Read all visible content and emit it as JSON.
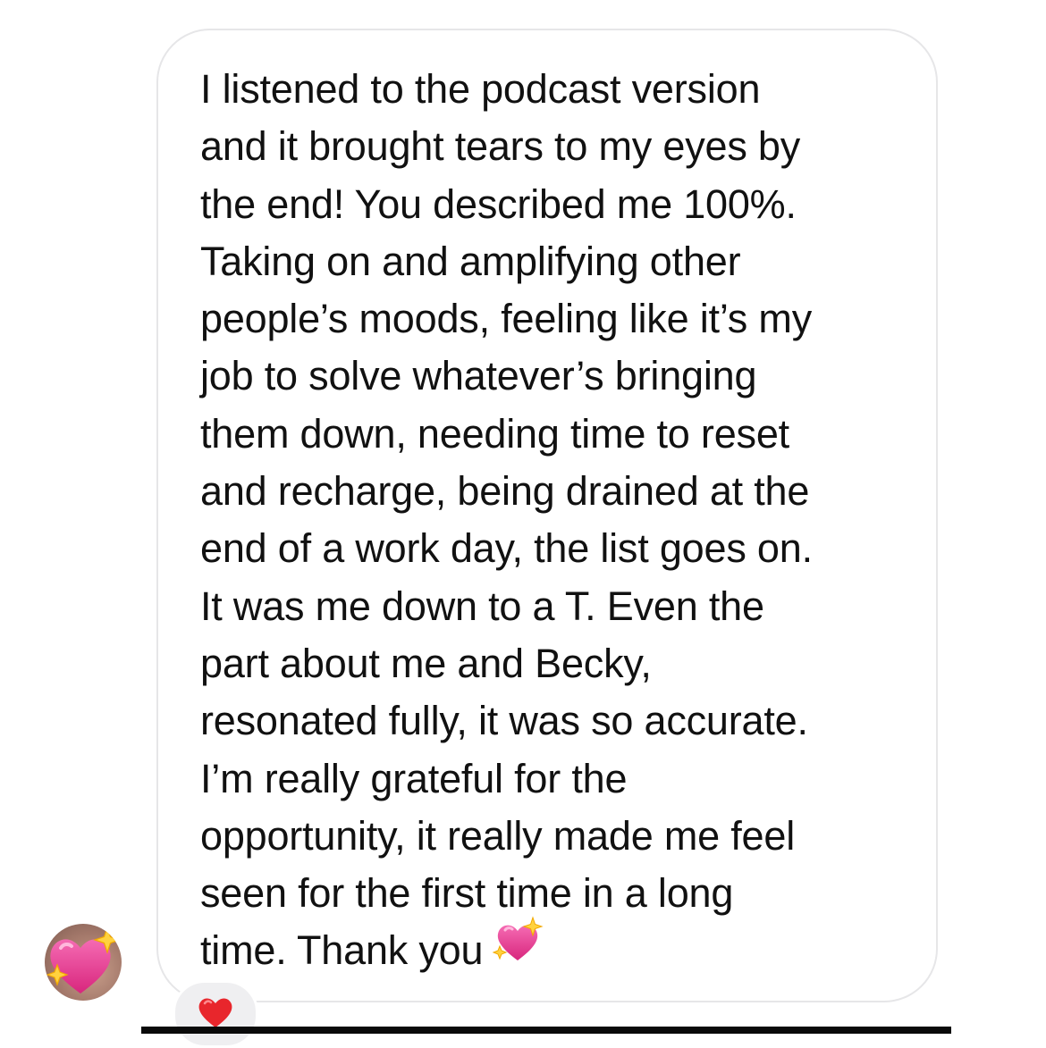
{
  "message": {
    "lines": [
      "I listened to the podcast version",
      "and it brought tears to my eyes by",
      "the end! You described me 100%.",
      "Taking on and amplifying other",
      "people’s moods, feeling like it’s my",
      "job to solve whatever’s bringing",
      "them down, needing time to reset",
      "and recharge, being drained at the",
      "end of a work day, the list goes on.",
      "It was me down to a T. Even the",
      "part about me and Becky,",
      "resonated fully, it was so accurate.",
      "I’m really grateful for the",
      "opportunity, it really made me feel",
      "seen for the first time in a long",
      "time. Thank you"
    ],
    "trailing_icon": "sparkling-heart-icon"
  },
  "sender": {
    "avatar_icon": "sparkling-heart-icon"
  },
  "reaction": {
    "icon": "red-heart-icon"
  },
  "colors": {
    "bubble_border": "#e6e6e8",
    "text": "#111111",
    "heart_pink": "#e0368c",
    "heart_red": "#e8262c",
    "reaction_bg": "#efeff1"
  }
}
